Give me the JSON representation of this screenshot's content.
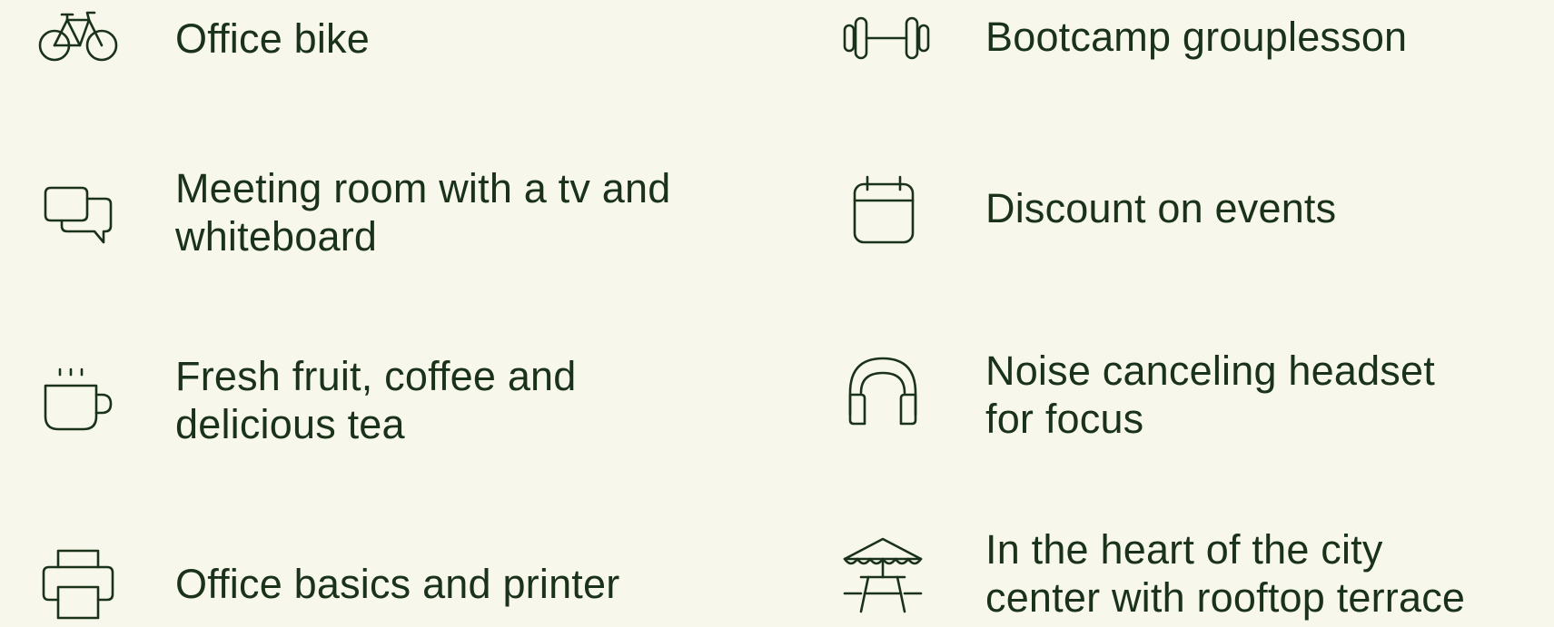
{
  "features": {
    "office_bike": {
      "icon": "bike-icon",
      "lines": [
        "Office bike"
      ]
    },
    "bootcamp": {
      "icon": "dumbbell-icon",
      "lines": [
        "Bootcamp grouplesson"
      ]
    },
    "meeting_room": {
      "icon": "chat-bubbles-icon",
      "lines": [
        "Meeting room with a tv and",
        "whiteboard"
      ]
    },
    "discount": {
      "icon": "calendar-icon",
      "lines": [
        "Discount on events"
      ]
    },
    "fruit_coffee": {
      "icon": "coffee-cup-icon",
      "lines": [
        "Fresh fruit, coffee and",
        "delicious tea"
      ]
    },
    "headset": {
      "icon": "headphones-icon",
      "lines": [
        "Noise canceling headset",
        "for focus"
      ]
    },
    "printer": {
      "icon": "printer-icon",
      "lines": [
        "Office basics and printer"
      ]
    },
    "city_center": {
      "icon": "picnic-table-umbrella-icon",
      "lines": [
        "In the heart of the city",
        "center with rooftop terrace"
      ]
    }
  },
  "colors": {
    "background": "#F8F7EC",
    "text": "#193219"
  }
}
